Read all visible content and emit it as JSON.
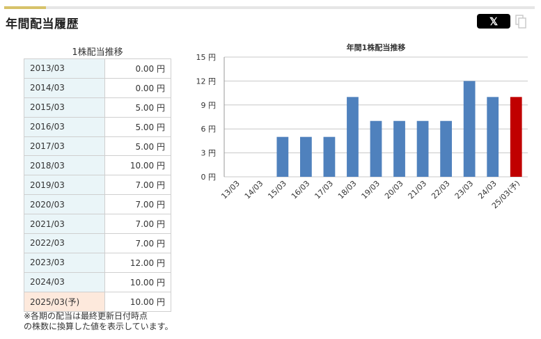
{
  "section_title": "年間配当履歴",
  "share": {
    "x_label": "𝕏"
  },
  "table": {
    "caption": "1株配当推移",
    "rows": [
      {
        "year": "2013/03",
        "amount": "0.00 円"
      },
      {
        "year": "2014/03",
        "amount": "0.00 円"
      },
      {
        "year": "2015/03",
        "amount": "5.00 円"
      },
      {
        "year": "2016/03",
        "amount": "5.00 円"
      },
      {
        "year": "2017/03",
        "amount": "5.00 円"
      },
      {
        "year": "2018/03",
        "amount": "10.00 円"
      },
      {
        "year": "2019/03",
        "amount": "7.00 円"
      },
      {
        "year": "2020/03",
        "amount": "7.00 円"
      },
      {
        "year": "2021/03",
        "amount": "7.00 円"
      },
      {
        "year": "2022/03",
        "amount": "7.00 円"
      },
      {
        "year": "2023/03",
        "amount": "12.00 円"
      },
      {
        "year": "2024/03",
        "amount": "10.00 円"
      },
      {
        "year": "2025/03(予)",
        "amount": "10.00 円",
        "forecast": true
      }
    ],
    "note_line1": "※各期の配当は最終更新日付時点",
    "note_line2": "の株数に換算した値を表示しています。"
  },
  "chart_data": {
    "type": "bar",
    "title": "年間1株配当推移",
    "categories": [
      "13/03",
      "14/03",
      "15/03",
      "16/03",
      "17/03",
      "18/03",
      "19/03",
      "20/03",
      "21/03",
      "22/03",
      "23/03",
      "24/03",
      "25/03(予)"
    ],
    "values": [
      0,
      0,
      5,
      5,
      5,
      10,
      7,
      7,
      7,
      7,
      12,
      10,
      10
    ],
    "forecast_index": 12,
    "ylim": [
      0,
      15
    ],
    "yticks": [
      0,
      3,
      6,
      9,
      12,
      15
    ],
    "ytick_labels": [
      "0 円",
      "3 円",
      "6 円",
      "9 円",
      "12 円",
      "15 円"
    ],
    "grid": true,
    "colors": {
      "bar": "#4f81bd",
      "forecast": "#c00000",
      "grid": "#c8c8c8"
    }
  }
}
